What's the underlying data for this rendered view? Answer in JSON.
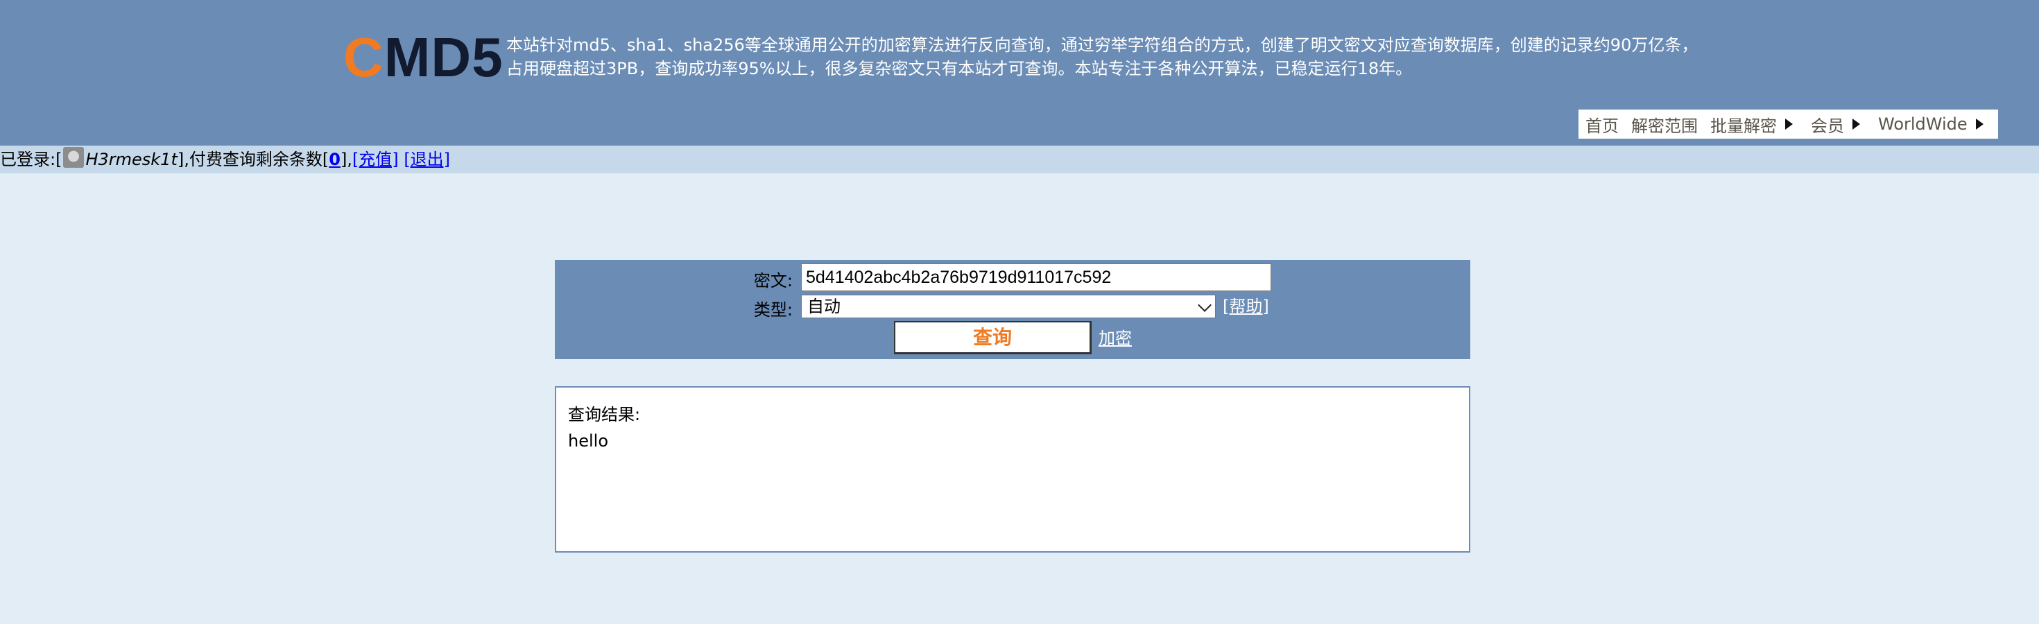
{
  "header": {
    "logo_c": "C",
    "logo_rest": "MD5",
    "intro_line1": "本站针对md5、sha1、sha256等全球通用公开的加密算法进行反向查询，通过穷举字符组合的方式，创建了明文密文对应查询数据库，创建的记录约90万亿条，",
    "intro_line2": "占用硬盘超过3PB，查询成功率95%以上，很多复杂密文只有本站才可查询。本站专注于各种公开算法，已稳定运行18年。",
    "nav": {
      "home": "首页",
      "scope": "解密范围",
      "batch": "批量解密",
      "member": "会员",
      "worldwide": "WorldWide"
    }
  },
  "login": {
    "prefix": "已登录:[",
    "username": "H3rmesk1t",
    "mid": "],付费查询剩余条数[",
    "count": "0",
    "sep": "],",
    "recharge": "[充值]",
    "logout": "[退出]"
  },
  "form": {
    "cipher_label": "密文:",
    "cipher_value": "5d41402abc4b2a76b9719d911017c592",
    "type_label": "类型:",
    "type_value": "自动",
    "help": "[帮助]",
    "query_button": "查询",
    "encrypt_link": "加密"
  },
  "result": {
    "title": "查询结果:",
    "value": "hello"
  },
  "colors": {
    "header_bg": "#6b8cb5",
    "page_bg": "#e2edf5",
    "login_bg": "#c6d9ea",
    "accent_orange": "#f07b22"
  }
}
